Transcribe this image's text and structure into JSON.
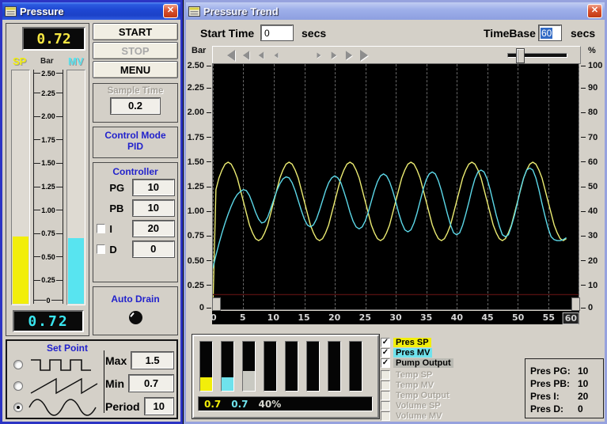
{
  "pressure_window": {
    "title": "Pressure",
    "top_display": "0.72",
    "bottom_display": "0.72",
    "sp_label": "SP",
    "unit_label": "Bar",
    "mv_label": "MV",
    "gauge": {
      "max": 2.5,
      "sp_value": 0.72,
      "mv_value": 0.7,
      "sp_color": "#f2ee0a",
      "mv_color": "#58e4f0",
      "ticks": [
        "2.50",
        "2.25",
        "2.00",
        "1.75",
        "1.50",
        "1.25",
        "1.00",
        "0.75",
        "0.50",
        "0.25",
        "0"
      ]
    },
    "buttons": {
      "start": "START",
      "stop": "STOP",
      "menu": "MENU"
    },
    "sample_time": {
      "label": "Sample Time",
      "value": "0.2"
    },
    "control_mode": {
      "label": "Control Mode",
      "value": "PID"
    },
    "controller": {
      "label": "Controller",
      "rows": [
        {
          "label": "PG",
          "value": "10",
          "has_checkbox": false,
          "checked": false
        },
        {
          "label": "PB",
          "value": "10",
          "has_checkbox": false,
          "checked": false
        },
        {
          "label": "I",
          "value": "20",
          "has_checkbox": true,
          "checked": false
        },
        {
          "label": "D",
          "value": "0",
          "has_checkbox": true,
          "checked": false
        }
      ]
    },
    "auto_drain": {
      "label": "Auto Drain"
    },
    "set_point": {
      "label": "Set Point",
      "waveforms": [
        {
          "name": "square",
          "selected": false
        },
        {
          "name": "sawtooth",
          "selected": false
        },
        {
          "name": "sine",
          "selected": true
        }
      ],
      "rows": [
        {
          "label": "Max",
          "value": "1.5"
        },
        {
          "label": "Min",
          "value": "0.7"
        },
        {
          "label": "Period",
          "value": "10"
        }
      ]
    }
  },
  "trend_window": {
    "title": "Pressure Trend",
    "start_time": {
      "label": "Start Time",
      "value": "0",
      "unit": "secs"
    },
    "timebase": {
      "label": "TimeBase",
      "value": "60",
      "unit": "secs",
      "selected": true
    },
    "axis_left_unit": "Bar",
    "axis_right_unit": "%",
    "left_ticks": [
      "2.50",
      "2.25",
      "2.00",
      "1.75",
      "1.50",
      "1.25",
      "1.00",
      "0.75",
      "0.50",
      "0.25",
      "0"
    ],
    "right_ticks": [
      "100",
      "90",
      "80",
      "70",
      "60",
      "50",
      "40",
      "30",
      "20",
      "10",
      "0"
    ],
    "x_ticks": [
      "0",
      "5",
      "10",
      "15",
      "20",
      "25",
      "30",
      "35",
      "40",
      "45",
      "50",
      "55",
      "60"
    ],
    "bar_panel": {
      "bars": [
        {
          "pct": 28,
          "color": "#f2ee0a"
        },
        {
          "pct": 27,
          "color": "#6fe2ec"
        },
        {
          "pct": 40,
          "color": "#c9c9c2"
        },
        {
          "pct": 0,
          "color": ""
        },
        {
          "pct": 0,
          "color": ""
        },
        {
          "pct": 0,
          "color": ""
        },
        {
          "pct": 0,
          "color": ""
        },
        {
          "pct": 0,
          "color": ""
        }
      ],
      "readout": [
        {
          "text": "0.7",
          "color": "#f2ee0a"
        },
        {
          "text": "0.7",
          "color": "#6fe2ec"
        },
        {
          "text": "40%",
          "color": "#d8d8d0"
        }
      ]
    },
    "legend": [
      {
        "label": "Pres SP",
        "checked": true,
        "highlight": "#f2ee0a"
      },
      {
        "label": "Pres MV",
        "checked": true,
        "highlight": "#6fe2ec"
      },
      {
        "label": "Pump Output",
        "checked": true,
        "highlight": "#b9b9b2"
      },
      {
        "label": "Temp SP",
        "checked": false,
        "highlight": ""
      },
      {
        "label": "Temp MV",
        "checked": false,
        "highlight": ""
      },
      {
        "label": "Temp Output",
        "checked": false,
        "highlight": ""
      },
      {
        "label": "Volume SP",
        "checked": false,
        "highlight": ""
      },
      {
        "label": "Volume MV",
        "checked": false,
        "highlight": ""
      }
    ],
    "params": [
      {
        "label": "Pres PG:",
        "value": "10"
      },
      {
        "label": "Pres PB:",
        "value": "10"
      },
      {
        "label": "Pres I:",
        "value": "20"
      },
      {
        "label": "Pres D:",
        "value": "0"
      }
    ]
  },
  "chart_data": {
    "type": "line",
    "title": "Pressure Trend",
    "xlabel": "secs",
    "ylabel_left": "Bar",
    "ylabel_right": "%",
    "xlim": [
      0,
      60
    ],
    "ylim_left": [
      0,
      2.5
    ],
    "ylim_right": [
      0,
      100
    ],
    "x_tick_step": 5,
    "grid": "vertical-dashed",
    "background": "#000000",
    "series": [
      {
        "name": "Pres SP",
        "axis": "left",
        "color": "#ecec72",
        "x_start": 0,
        "x_step": 0.5,
        "y": [
          0.0,
          1.22,
          1.34,
          1.42,
          1.48,
          1.5,
          1.48,
          1.42,
          1.34,
          1.22,
          1.1,
          0.98,
          0.86,
          0.78,
          0.72,
          0.7,
          0.72,
          0.78,
          0.86,
          0.98,
          1.1,
          1.22,
          1.34,
          1.42,
          1.48,
          1.5,
          1.48,
          1.42,
          1.34,
          1.22,
          1.1,
          0.98,
          0.86,
          0.78,
          0.72,
          0.7,
          0.72,
          0.78,
          0.86,
          0.98,
          1.1,
          1.22,
          1.34,
          1.42,
          1.48,
          1.5,
          1.48,
          1.42,
          1.34,
          1.22,
          1.1,
          0.98,
          0.86,
          0.78,
          0.72,
          0.7,
          0.72,
          0.78,
          0.86,
          0.98,
          1.1,
          1.22,
          1.34,
          1.42,
          1.48,
          1.5,
          1.48,
          1.42,
          1.34,
          1.22,
          1.1,
          0.98,
          0.86,
          0.78,
          0.72,
          0.7,
          0.72,
          0.78,
          0.86,
          0.98,
          1.1,
          1.22,
          1.34,
          1.42,
          1.48,
          1.5,
          1.48,
          1.42,
          1.34,
          1.22,
          1.1,
          0.98,
          0.86,
          0.78,
          0.72,
          0.7,
          0.72,
          0.78,
          0.86,
          0.98,
          1.1,
          1.22,
          1.34,
          1.42,
          1.48,
          1.5,
          1.48,
          1.42,
          1.34,
          1.22,
          1.1,
          0.98,
          0.86,
          0.78,
          0.72,
          0.7,
          0.72
        ]
      },
      {
        "name": "Pres MV",
        "axis": "left",
        "color": "#5cd8e8",
        "x_start": 0,
        "x_step": 0.5,
        "y": [
          0.42,
          0.55,
          0.67,
          0.78,
          0.88,
          0.97,
          1.05,
          1.12,
          1.17,
          1.2,
          1.22,
          1.21,
          1.16,
          1.08,
          0.99,
          0.92,
          0.88,
          0.89,
          0.94,
          1.03,
          1.12,
          1.21,
          1.28,
          1.33,
          1.35,
          1.34,
          1.29,
          1.21,
          1.11,
          1.01,
          0.92,
          0.86,
          0.84,
          0.86,
          0.92,
          1.01,
          1.11,
          1.21,
          1.29,
          1.34,
          1.36,
          1.34,
          1.29,
          1.2,
          1.1,
          0.99,
          0.9,
          0.84,
          0.82,
          0.84,
          0.9,
          0.99,
          1.1,
          1.21,
          1.3,
          1.36,
          1.38,
          1.36,
          1.3,
          1.21,
          1.1,
          0.98,
          0.88,
          0.81,
          0.79,
          0.81,
          0.88,
          0.98,
          1.1,
          1.22,
          1.32,
          1.38,
          1.4,
          1.38,
          1.31,
          1.21,
          1.09,
          0.97,
          0.86,
          0.78,
          0.76,
          0.78,
          0.86,
          0.97,
          1.09,
          1.22,
          1.33,
          1.4,
          1.42,
          1.4,
          1.33,
          1.22,
          1.09,
          0.96,
          0.85,
          0.76,
          0.74,
          0.76,
          0.85,
          0.96,
          1.09,
          1.23,
          1.34,
          1.42,
          1.44,
          1.42,
          1.34,
          1.22,
          1.08,
          0.95,
          0.83,
          0.74,
          0.71,
          0.7,
          0.7,
          0.71,
          0.73
        ]
      },
      {
        "name": "Pump Output",
        "axis": "right",
        "color": "#521010",
        "x_start": 0,
        "x_step": 60,
        "y": [
          6,
          6
        ]
      }
    ]
  }
}
